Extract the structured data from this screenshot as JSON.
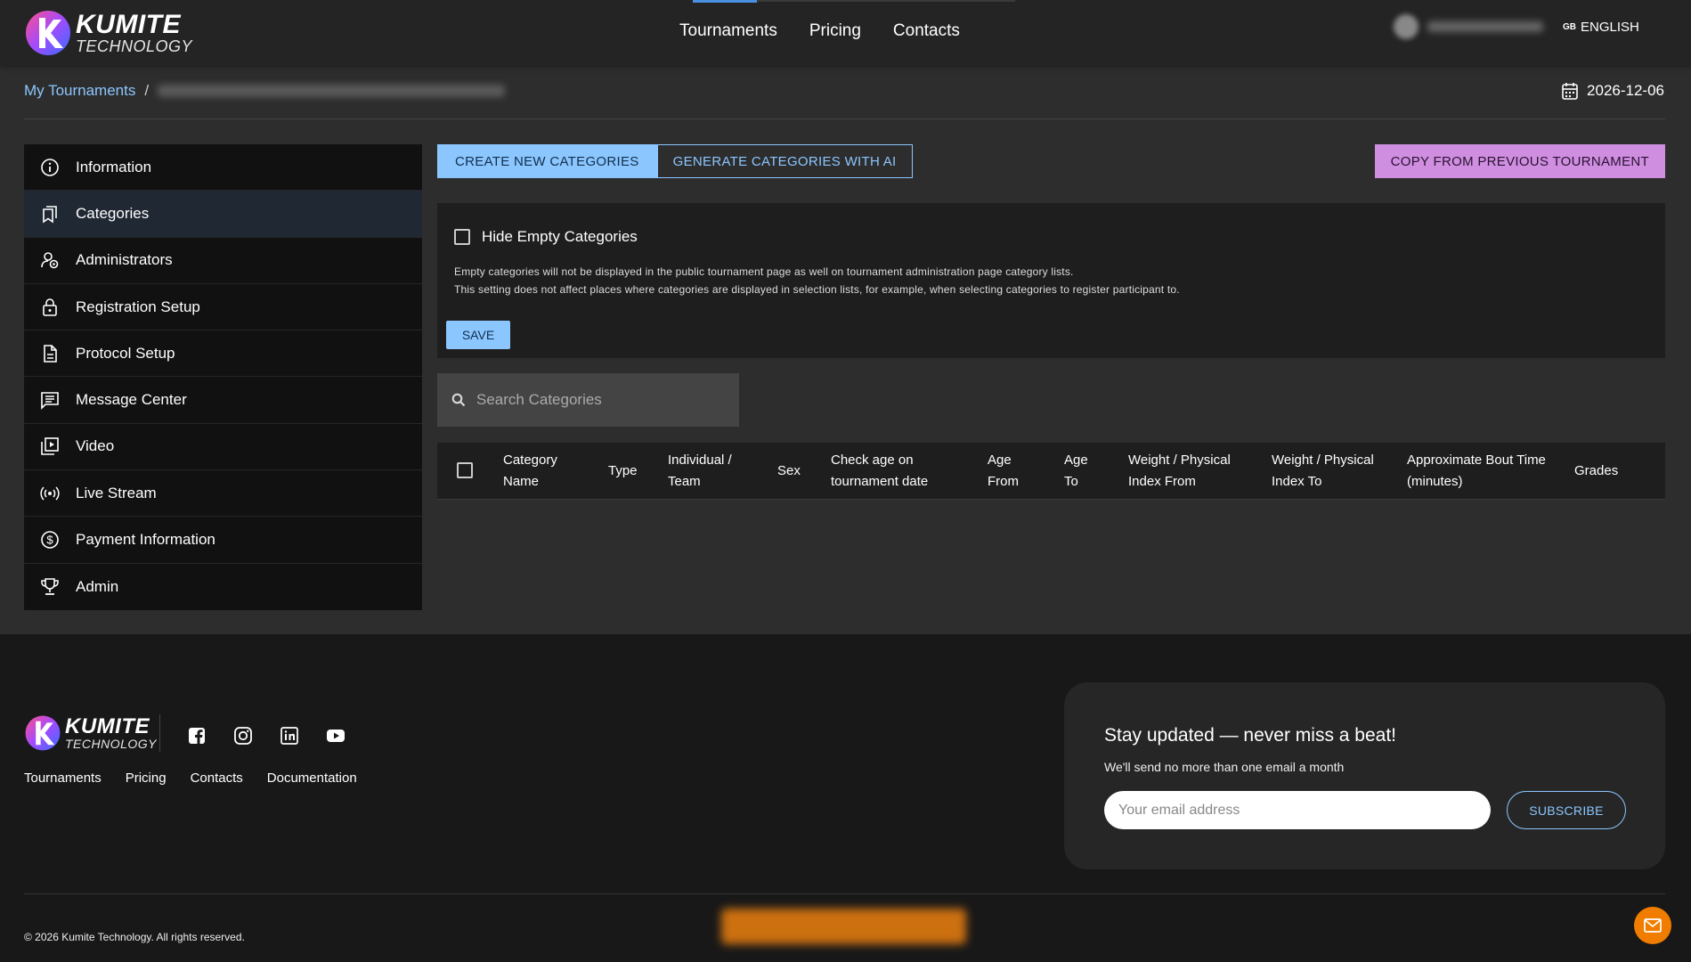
{
  "brand": {
    "name_line1": "KUMITE",
    "name_line2": "TECHNOLOGY"
  },
  "nav": {
    "items": [
      "Tournaments",
      "Pricing",
      "Contacts"
    ]
  },
  "header": {
    "language_code": "GB",
    "language": "ENGLISH"
  },
  "breadcrumb": {
    "root": "My Tournaments",
    "separator": "/"
  },
  "date": "2026-12-06",
  "sidebar": {
    "items": [
      {
        "label": "Information",
        "icon": "info-icon"
      },
      {
        "label": "Categories",
        "icon": "bookmarks-icon"
      },
      {
        "label": "Administrators",
        "icon": "admin-user-icon"
      },
      {
        "label": "Registration Setup",
        "icon": "lock-icon"
      },
      {
        "label": "Protocol Setup",
        "icon": "document-icon"
      },
      {
        "label": "Message Center",
        "icon": "message-icon"
      },
      {
        "label": "Video",
        "icon": "video-library-icon"
      },
      {
        "label": "Live Stream",
        "icon": "broadcast-icon"
      },
      {
        "label": "Payment Information",
        "icon": "dollar-icon"
      },
      {
        "label": "Admin",
        "icon": "trophy-icon"
      }
    ],
    "active_index": 1
  },
  "toolbar": {
    "create_label": "CREATE NEW CATEGORIES",
    "generate_label": "GENERATE CATEGORIES WITH AI",
    "copy_label": "COPY FROM PREVIOUS TOURNAMENT"
  },
  "settings": {
    "hide_empty_label": "Hide Empty Categories",
    "hide_empty_checked": false,
    "desc_line1": "Empty categories will not be displayed in the public tournament page as well on tournament administration page category lists.",
    "desc_line2": "This setting does not affect places where categories are displayed in selection lists, for example, when selecting categories to register participant to.",
    "save_label": "SAVE"
  },
  "search": {
    "placeholder": "Search Categories",
    "value": ""
  },
  "table": {
    "columns": [
      {
        "line1": "Category",
        "line2": "Name"
      },
      {
        "line1": "Type",
        "line2": ""
      },
      {
        "line1": "Individual /",
        "line2": "Team"
      },
      {
        "line1": "Sex",
        "line2": ""
      },
      {
        "line1": "Check age on",
        "line2": "tournament date"
      },
      {
        "line1": "Age",
        "line2": "From"
      },
      {
        "line1": "Age",
        "line2": "To"
      },
      {
        "line1": "Weight / Physical",
        "line2": "Index From"
      },
      {
        "line1": "Weight / Physical",
        "line2": "Index To"
      },
      {
        "line1": "Approximate Bout Time",
        "line2": "(minutes)"
      },
      {
        "line1": "Grades",
        "line2": ""
      }
    ],
    "rows": []
  },
  "footer": {
    "links": [
      "Tournaments",
      "Pricing",
      "Contacts",
      "Documentation"
    ],
    "socials": [
      "facebook-icon",
      "instagram-icon",
      "linkedin-icon",
      "youtube-icon"
    ],
    "newsletter_title": "Stay updated — never miss a beat!",
    "newsletter_sub": "We'll send no more than one email a month",
    "email_placeholder": "Your email address",
    "subscribe_label": "SUBSCRIBE",
    "copyright": "© 2026 Kumite Technology. All rights reserved."
  },
  "colors": {
    "accent": "#8cc6ff",
    "copy_button": "#cf8ee0",
    "chat_button": "#f07d00",
    "nav_indicator": "#4a90e2"
  }
}
